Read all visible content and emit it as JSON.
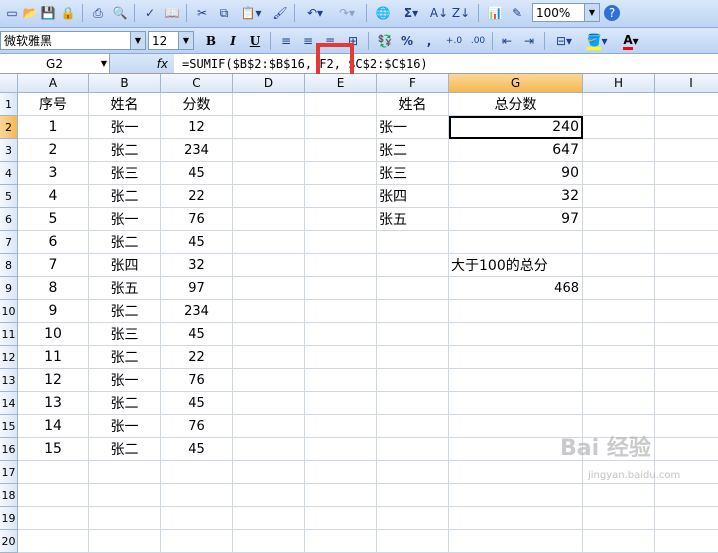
{
  "toolbar1": {
    "zoom": "100%",
    "sum_symbol": "Σ"
  },
  "toolbar2": {
    "font_name": "微软雅黑",
    "font_size": "12",
    "bold": "B",
    "italic": "I",
    "underline": "U",
    "percent": "%",
    "comma": ","
  },
  "formula_bar": {
    "name_box": "G2",
    "fx": "fx",
    "formula": "=SUMIF($B$2:$B$16, F2, $C$2:$C$16)"
  },
  "columns": [
    "A",
    "B",
    "C",
    "D",
    "E",
    "F",
    "G",
    "H",
    "I"
  ],
  "rows": [
    "1",
    "2",
    "3",
    "4",
    "5",
    "6",
    "7",
    "8",
    "9",
    "10",
    "11",
    "12",
    "13",
    "14",
    "15",
    "16",
    "17",
    "18",
    "19",
    "20"
  ],
  "table_left": {
    "headers": [
      "序号",
      "姓名",
      "分数"
    ],
    "rows": [
      [
        "1",
        "张一",
        "12"
      ],
      [
        "2",
        "张二",
        "234"
      ],
      [
        "3",
        "张三",
        "45"
      ],
      [
        "4",
        "张二",
        "22"
      ],
      [
        "5",
        "张一",
        "76"
      ],
      [
        "6",
        "张二",
        "45"
      ],
      [
        "7",
        "张四",
        "32"
      ],
      [
        "8",
        "张五",
        "97"
      ],
      [
        "9",
        "张二",
        "234"
      ],
      [
        "10",
        "张三",
        "45"
      ],
      [
        "11",
        "张二",
        "22"
      ],
      [
        "12",
        "张一",
        "76"
      ],
      [
        "13",
        "张二",
        "45"
      ],
      [
        "14",
        "张一",
        "76"
      ],
      [
        "15",
        "张二",
        "45"
      ]
    ]
  },
  "summary": {
    "headers": [
      "姓名",
      "总分数"
    ],
    "rows": [
      [
        "张一",
        "240"
      ],
      [
        "张二",
        "647"
      ],
      [
        "张三",
        "90"
      ],
      [
        "张四",
        "32"
      ],
      [
        "张五",
        "97"
      ]
    ],
    "over100_label": "大于100的总分",
    "over100_value": "468"
  },
  "watermark": {
    "main": "Bai 经验",
    "sub": "jingyan.baidu.com"
  }
}
